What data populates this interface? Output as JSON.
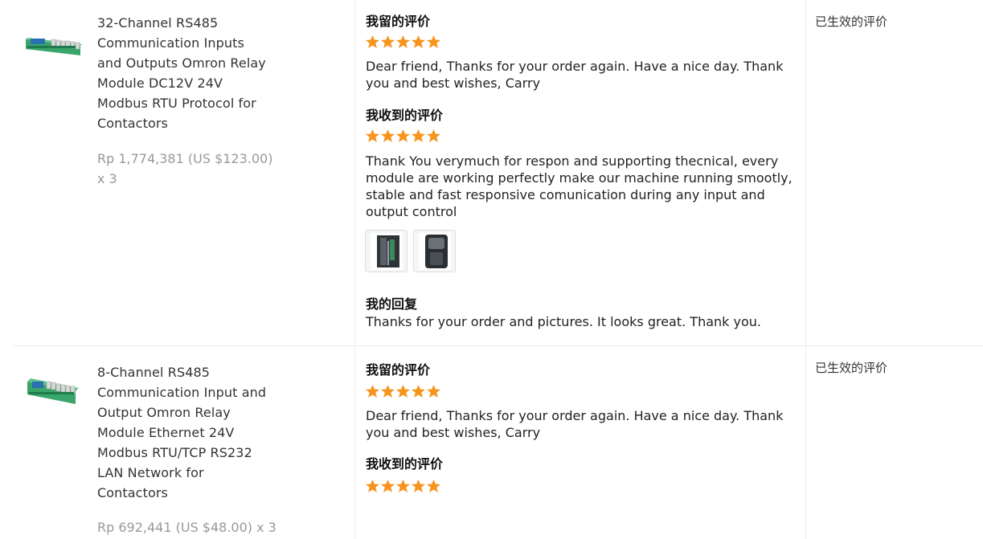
{
  "orders": [
    {
      "product_title": "32-Channel RS485 Communication Inputs and Outputs Omron Relay Module DC12V 24V Modbus RTU Protocol for Contactors",
      "price": "Rp 1,774,381 (US $123.00) x 3",
      "my_review_heading": "我留的评价",
      "my_review_stars": 5,
      "my_review_text": "Dear friend, Thanks for your order again. Have a nice day. Thank you and best wishes, Carry",
      "received_review_heading": "我收到的评价",
      "received_review_stars": 5,
      "received_review_text": "Thank You verymuch for respon and supporting thecnical, every module are working perfectly make our machine running smootly, stable and fast responsive comunication during any input and output control",
      "received_review_images": [
        "review-photo-1",
        "review-photo-2"
      ],
      "reply_heading": "我的回复",
      "reply_text": "Thanks for your order and pictures. It looks great. Thank you.",
      "status": "已生效的评价"
    },
    {
      "product_title": "8-Channel RS485 Communication Input and Output Omron Relay Module Ethernet 24V Modbus RTU/TCP RS232 LAN Network for Contactors",
      "price": "Rp 692,441 (US $48.00) x 3",
      "my_review_heading": "我留的评价",
      "my_review_stars": 5,
      "my_review_text": "Dear friend, Thanks for your order again. Have a nice day. Thank you and best wishes, Carry",
      "received_review_heading": "我收到的评价",
      "received_review_stars": 5,
      "status": "已生效的评价"
    }
  ],
  "colors": {
    "star": "#f7941d",
    "price": "#999999",
    "divider": "#ececec"
  },
  "icons": {
    "star": "star-icon",
    "product_thumb": "relay-module-thumbnail"
  }
}
